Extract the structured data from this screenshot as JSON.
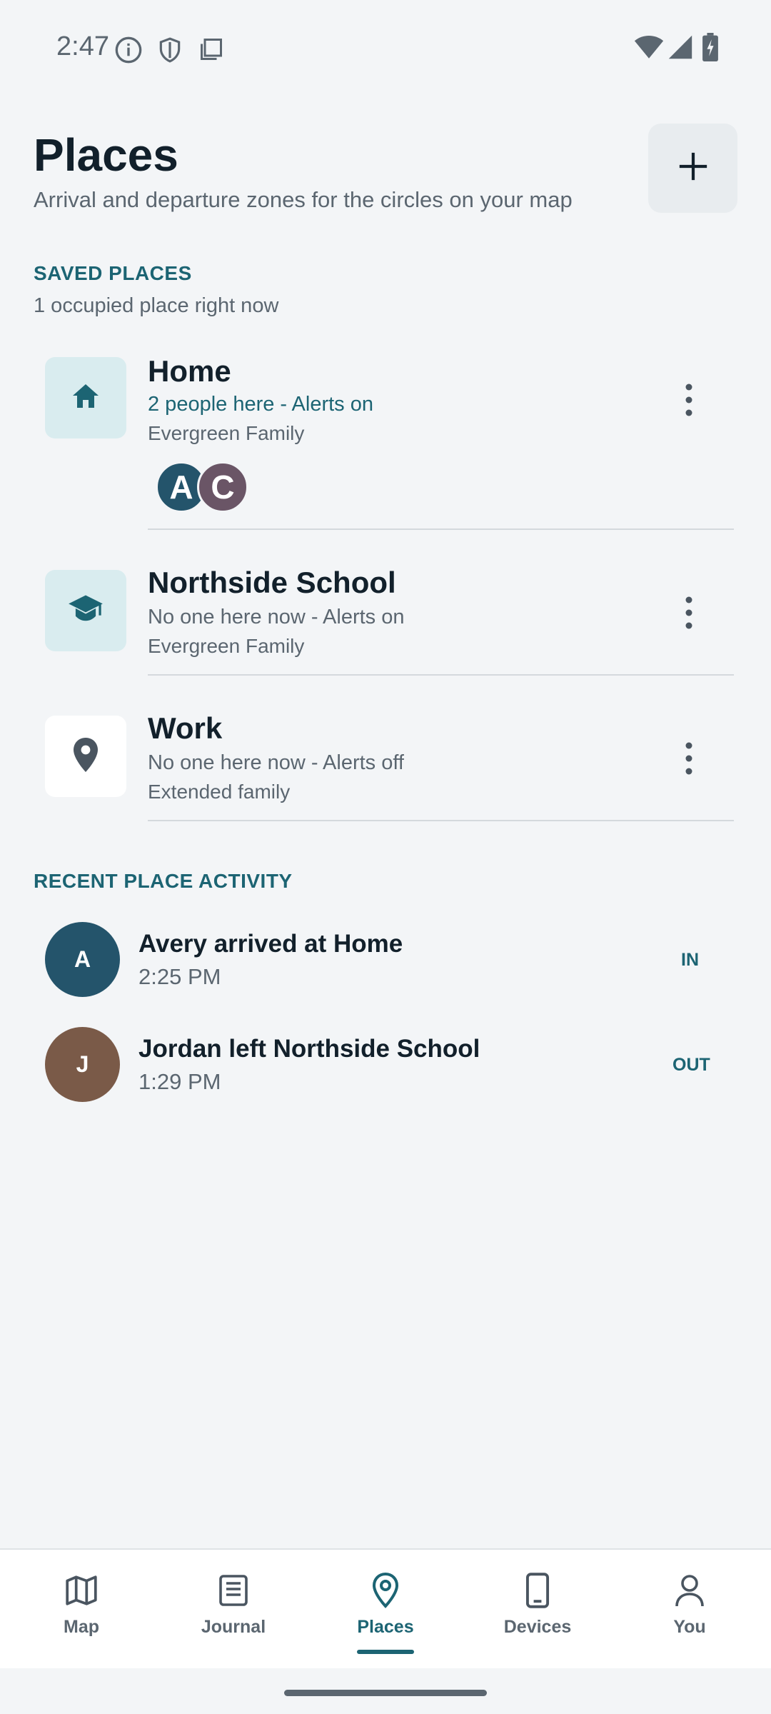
{
  "status_bar": {
    "time": "2:47"
  },
  "header": {
    "title": "Places",
    "subtitle": "Arrival and departure zones for the circles on your map",
    "add_icon": "plus-icon"
  },
  "saved": {
    "label": "SAVED PLACES",
    "summary": "1 occupied place right now",
    "items": [
      {
        "name": "Home",
        "status": "2 people here - Alerts on",
        "circle": "Evergreen Family",
        "icon": "home-icon",
        "status_color": "#1c6473",
        "avatars": [
          "A",
          "C"
        ],
        "avatar_colors": [
          "#24546b",
          "#6a5566"
        ]
      },
      {
        "name": "Northside School",
        "status": "No one here now - Alerts on",
        "circle": "Evergreen Family",
        "icon": "school-icon",
        "status_color": "#5b6670"
      },
      {
        "name": "Work",
        "status": "No one here now - Alerts off",
        "circle": "Extended family",
        "icon": "pin-icon",
        "status_color": "#5b6670"
      }
    ]
  },
  "activity": {
    "label": "RECENT PLACE ACTIVITY",
    "items": [
      {
        "initial": "A",
        "text": "Avery arrived at Home",
        "time": "2:25 PM",
        "badge": "IN",
        "color": "#24546b"
      },
      {
        "initial": "J",
        "text": "Jordan left Northside School",
        "time": "1:29 PM",
        "badge": "OUT",
        "color": "#7a5a48"
      }
    ]
  },
  "nav": {
    "items": [
      {
        "label": "Map",
        "icon": "map-icon"
      },
      {
        "label": "Journal",
        "icon": "journal-icon"
      },
      {
        "label": "Places",
        "icon": "place-pin-icon",
        "active": true
      },
      {
        "label": "Devices",
        "icon": "phone-icon"
      },
      {
        "label": "You",
        "icon": "person-icon"
      }
    ]
  },
  "colors": {
    "accent": "#1c6473",
    "background": "#f3f5f7"
  }
}
